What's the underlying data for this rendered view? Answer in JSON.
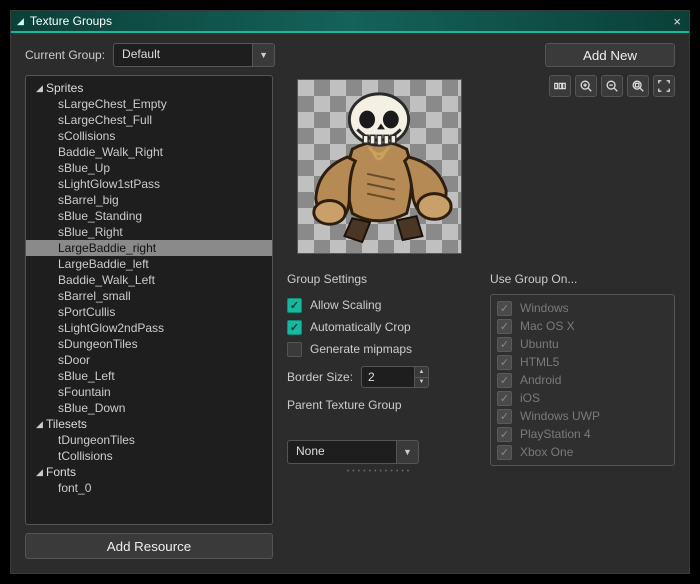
{
  "window": {
    "title": "Texture Groups"
  },
  "toolbar": {
    "current_group_label": "Current Group:",
    "current_group_value": "Default",
    "add_new_label": "Add New"
  },
  "tree": {
    "groups": [
      {
        "label": "Sprites",
        "items": [
          "sLargeChest_Empty",
          "sLargeChest_Full",
          "sCollisions",
          "Baddie_Walk_Right",
          "sBlue_Up",
          "sLightGlow1stPass",
          "sBarrel_big",
          "sBlue_Standing",
          "sBlue_Right",
          "LargeBaddie_right",
          "LargeBaddie_left",
          "Baddie_Walk_Left",
          "sBarrel_small",
          "sPortCullis",
          "sLightGlow2ndPass",
          "sDungeonTiles",
          "sDoor",
          "sBlue_Left",
          "sFountain",
          "sBlue_Down"
        ],
        "selected_index": 9
      },
      {
        "label": "Tilesets",
        "items": [
          "tDungeonTiles",
          "tCollisions"
        ],
        "selected_index": -1
      },
      {
        "label": "Fonts",
        "items": [
          "font_0"
        ],
        "selected_index": -1
      }
    ],
    "add_resource_label": "Add Resource"
  },
  "settings": {
    "title": "Group Settings",
    "allow_scaling": {
      "label": "Allow Scaling",
      "checked": true
    },
    "auto_crop": {
      "label": "Automatically Crop",
      "checked": true
    },
    "gen_mipmaps": {
      "label": "Generate mipmaps",
      "checked": false
    },
    "border_size_label": "Border Size:",
    "border_size_value": "2",
    "parent_group_label": "Parent Texture Group",
    "parent_group_value": "None"
  },
  "use_group": {
    "title": "Use Group On...",
    "platforms": [
      "Windows",
      "Mac OS X",
      "Ubuntu",
      "HTML5",
      "Android",
      "iOS",
      "Windows UWP",
      "PlayStation 4",
      "Xbox One"
    ]
  },
  "zoom_tools": {
    "scale_mode": "zoom-1to1",
    "zoom_in": "zoom-in",
    "zoom_out": "zoom-out",
    "fit": "fit-screen",
    "fullscreen": "fullscreen"
  }
}
